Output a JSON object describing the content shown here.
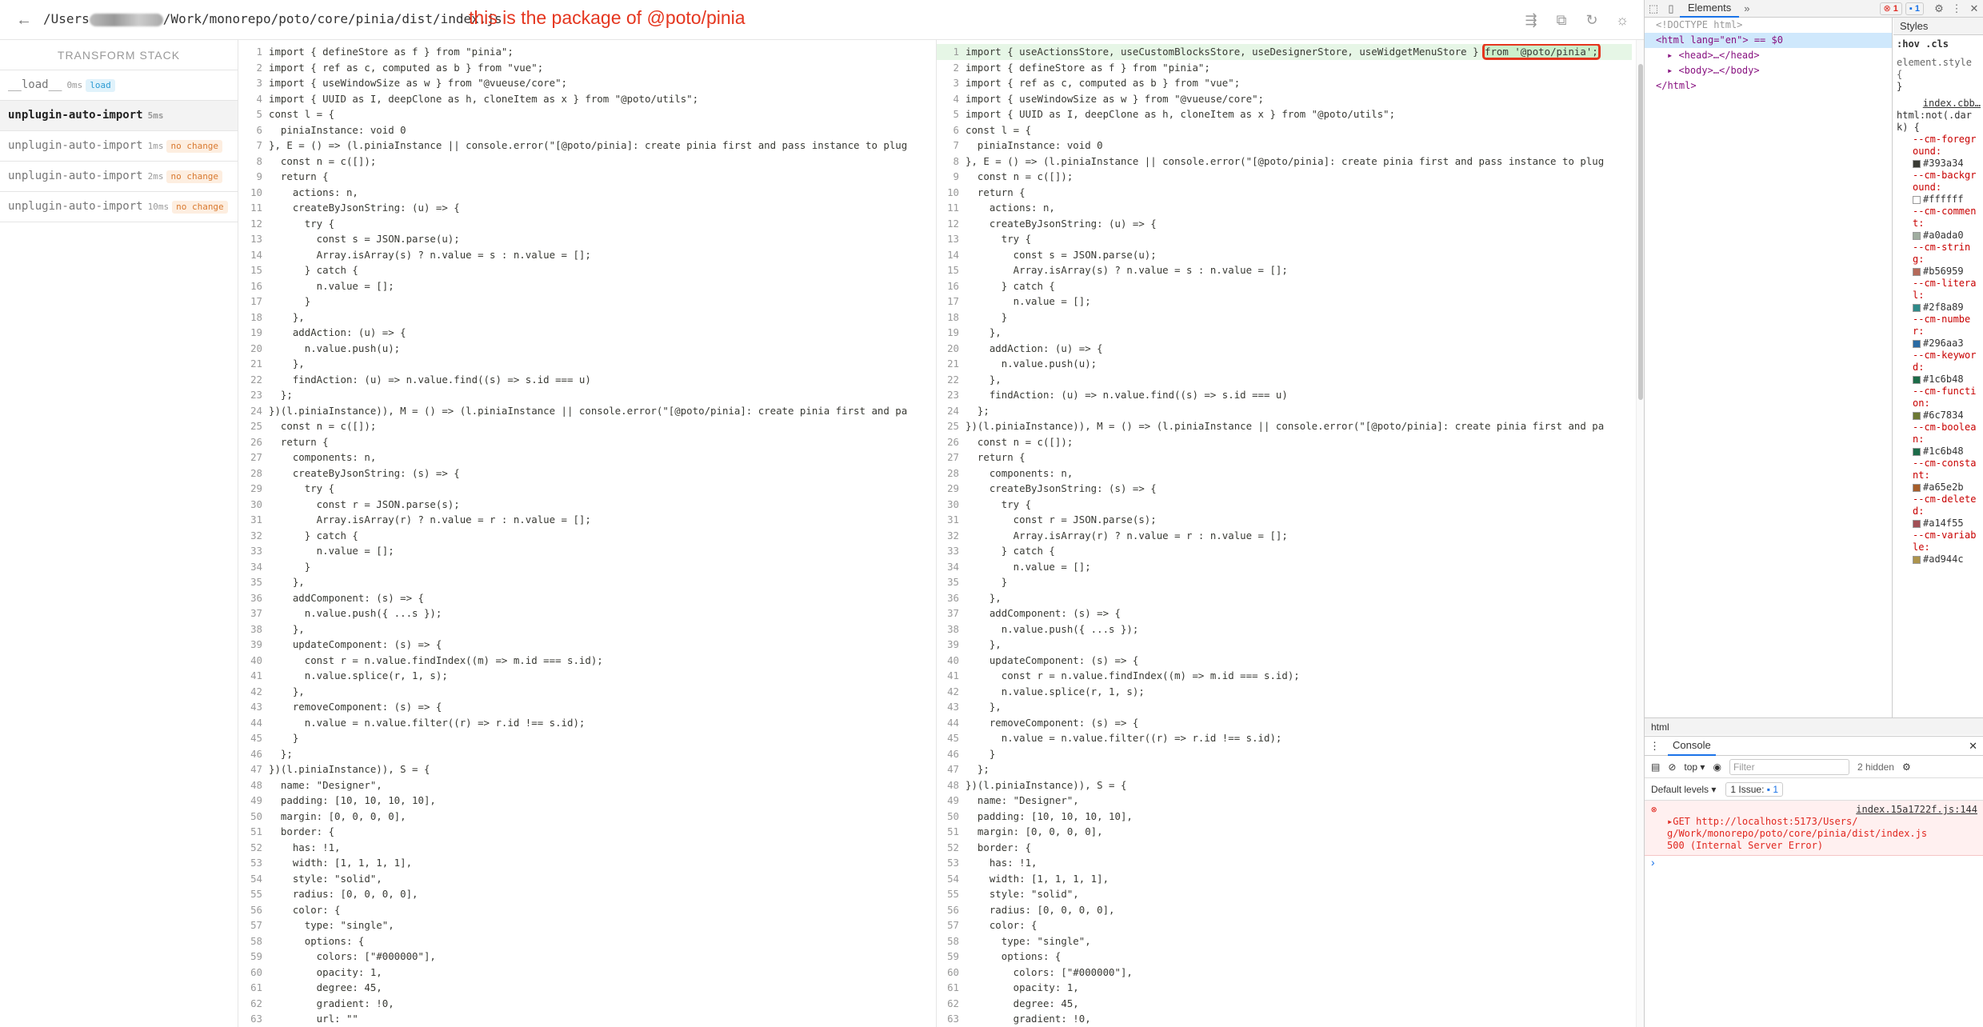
{
  "topbar": {
    "path_prefix": "/Users",
    "path_suffix": "/Work/monorepo/poto/core/pinia/dist/index.js",
    "annotation": "this is the package of @poto/pinia"
  },
  "stack": {
    "title": "TRANSFORM STACK",
    "items": [
      {
        "name": "__load__",
        "ms": "0ms",
        "badge": "load"
      },
      {
        "name": "unplugin-auto-import",
        "ms": "5ms",
        "badge": ""
      },
      {
        "name": "unplugin-auto-import",
        "ms": "1ms",
        "badge": "no change"
      },
      {
        "name": "unplugin-auto-import",
        "ms": "2ms",
        "badge": "no change"
      },
      {
        "name": "unplugin-auto-import",
        "ms": "10ms",
        "badge": "no change"
      }
    ]
  },
  "code_left": [
    "import { defineStore as f } from \"pinia\";",
    "import { ref as c, computed as b } from \"vue\";",
    "import { useWindowSize as w } from \"@vueuse/core\";",
    "import { UUID as I, deepClone as h, cloneItem as x } from \"@poto/utils\";",
    "const l = {",
    "  piniaInstance: void 0",
    "}, E = () => (l.piniaInstance || console.error(\"[@poto/pinia]: create pinia first and pass instance to plug",
    "  const n = c([]);",
    "  return {",
    "    actions: n,",
    "    createByJsonString: (u) => {",
    "      try {",
    "        const s = JSON.parse(u);",
    "        Array.isArray(s) ? n.value = s : n.value = [];",
    "      } catch {",
    "        n.value = [];",
    "      }",
    "    },",
    "    addAction: (u) => {",
    "      n.value.push(u);",
    "    },",
    "    findAction: (u) => n.value.find((s) => s.id === u)",
    "  };",
    "})(l.piniaInstance)), M = () => (l.piniaInstance || console.error(\"[@poto/pinia]: create pinia first and pa",
    "  const n = c([]);",
    "  return {",
    "    components: n,",
    "    createByJsonString: (s) => {",
    "      try {",
    "        const r = JSON.parse(s);",
    "        Array.isArray(r) ? n.value = r : n.value = [];",
    "      } catch {",
    "        n.value = [];",
    "      }",
    "    },",
    "    addComponent: (s) => {",
    "      n.value.push({ ...s });",
    "    },",
    "    updateComponent: (s) => {",
    "      const r = n.value.findIndex((m) => m.id === s.id);",
    "      n.value.splice(r, 1, s);",
    "    },",
    "    removeComponent: (s) => {",
    "      n.value = n.value.filter((r) => r.id !== s.id);",
    "    }",
    "  };",
    "})(l.piniaInstance)), S = {",
    "  name: \"Designer\",",
    "  padding: [10, 10, 10, 10],",
    "  margin: [0, 0, 0, 0],",
    "  border: {",
    "    has: !1,",
    "    width: [1, 1, 1, 1],",
    "    style: \"solid\",",
    "    radius: [0, 0, 0, 0],",
    "    color: {",
    "      type: \"single\",",
    "      options: {",
    "        colors: [\"#000000\"],",
    "        opacity: 1,",
    "        degree: 45,",
    "        gradient: !0,",
    "        url: \"\""
  ],
  "code_right_first_prefix": "import { useActionsStore, useCustomBlocksStore, useDesignerStore, useWidgetMenuStore } ",
  "code_right_first_box": "from '@poto/pinia';",
  "code_right": [
    "import { defineStore as f } from \"pinia\";",
    "import { ref as c, computed as b } from \"vue\";",
    "import { useWindowSize as w } from \"@vueuse/core\";",
    "import { UUID as I, deepClone as h, cloneItem as x } from \"@poto/utils\";",
    "const l = {",
    "  piniaInstance: void 0",
    "}, E = () => (l.piniaInstance || console.error(\"[@poto/pinia]: create pinia first and pass instance to plug",
    "  const n = c([]);",
    "  return {",
    "    actions: n,",
    "    createByJsonString: (u) => {",
    "      try {",
    "        const s = JSON.parse(u);",
    "        Array.isArray(s) ? n.value = s : n.value = [];",
    "      } catch {",
    "        n.value = [];",
    "      }",
    "    },",
    "    addAction: (u) => {",
    "      n.value.push(u);",
    "    },",
    "    findAction: (u) => n.value.find((s) => s.id === u)",
    "  };",
    "})(l.piniaInstance)), M = () => (l.piniaInstance || console.error(\"[@poto/pinia]: create pinia first and pa",
    "  const n = c([]);",
    "  return {",
    "    components: n,",
    "    createByJsonString: (s) => {",
    "      try {",
    "        const r = JSON.parse(s);",
    "        Array.isArray(r) ? n.value = r : n.value = [];",
    "      } catch {",
    "        n.value = [];",
    "      }",
    "    },",
    "    addComponent: (s) => {",
    "      n.value.push({ ...s });",
    "    },",
    "    updateComponent: (s) => {",
    "      const r = n.value.findIndex((m) => m.id === s.id);",
    "      n.value.splice(r, 1, s);",
    "    },",
    "    removeComponent: (s) => {",
    "      n.value = n.value.filter((r) => r.id !== s.id);",
    "    }",
    "  };",
    "})(l.piniaInstance)), S = {",
    "  name: \"Designer\",",
    "  padding: [10, 10, 10, 10],",
    "  margin: [0, 0, 0, 0],",
    "  border: {",
    "    has: !1,",
    "    width: [1, 1, 1, 1],",
    "    style: \"solid\",",
    "    radius: [0, 0, 0, 0],",
    "    color: {",
    "      type: \"single\",",
    "      options: {",
    "        colors: [\"#000000\"],",
    "        opacity: 1,",
    "        degree: 45,",
    "        gradient: !0,"
  ],
  "devtools": {
    "tab": "Elements",
    "error_count": "1",
    "msg_count": "1",
    "dom": [
      "<!DOCTYPE html>",
      "<html lang=\"en\"> == $0",
      "<head>…</head>",
      "<body>…</body>",
      "</html>"
    ],
    "styles_tab": "Styles",
    "styles_filter": ":hov .cls",
    "element_style": "element.style {",
    "element_style_close": "}",
    "source_file": "index.cbb…",
    "selector": "html:not(.dark) {",
    "vars": [
      {
        "name": "--cm-foreground",
        "value": "#393a34",
        "color": "#393a34"
      },
      {
        "name": "--cm-background",
        "value": "#ffffff",
        "color": "#ffffff"
      },
      {
        "name": "--cm-comment",
        "value": "#a0ada0",
        "color": "#a0ada0"
      },
      {
        "name": "--cm-string",
        "value": "#b56959",
        "color": "#b56959"
      },
      {
        "name": "--cm-literal",
        "value": "#2f8a89",
        "color": "#2f8a89"
      },
      {
        "name": "--cm-number",
        "value": "#296aa3",
        "color": "#296aa3"
      },
      {
        "name": "--cm-keyword",
        "value": "#1c6b48",
        "color": "#1c6b48"
      },
      {
        "name": "--cm-function",
        "value": "#6c7834",
        "color": "#6c7834"
      },
      {
        "name": "--cm-boolean",
        "value": "#1c6b48",
        "color": "#1c6b48"
      },
      {
        "name": "--cm-constant",
        "value": "#a65e2b",
        "color": "#a65e2b"
      },
      {
        "name": "--cm-deleted",
        "value": "#a14f55",
        "color": "#a14f55"
      },
      {
        "name": "--cm-variable",
        "value": "#ad944c",
        "color": "#ad944c"
      }
    ],
    "breadcrumb": "html",
    "console_tab": "Console",
    "context": "top",
    "filter_placeholder": "Filter",
    "hidden": "2 hidden",
    "levels": "Default levels",
    "issues": "1 Issue:",
    "issues_count": "1",
    "err_source": "index.15a1722f.js:144",
    "err_line1": "GET http://localhost:5173/Users/",
    "err_line2": "g/Work/monorepo/poto/core/pinia/dist/index.js",
    "err_line3": "500 (Internal Server Error)"
  }
}
